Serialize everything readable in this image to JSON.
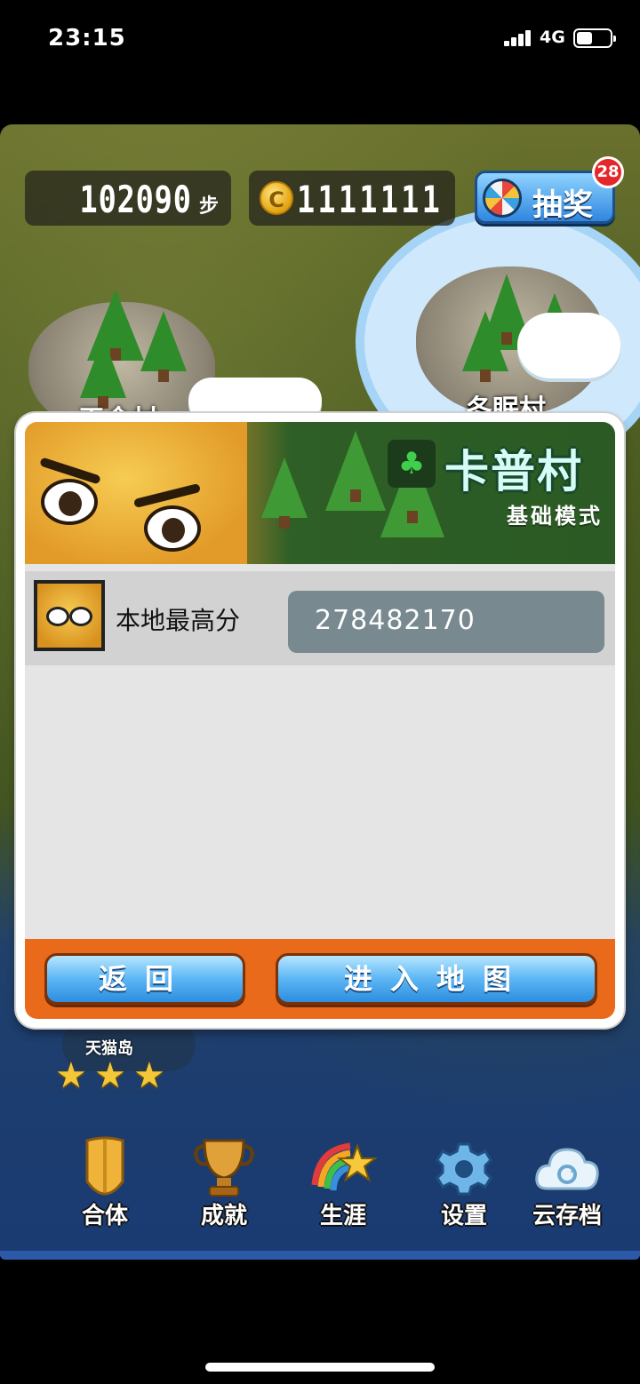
{
  "status_bar": {
    "time": "23:15",
    "network": "4G"
  },
  "hud": {
    "steps_value": "102090",
    "steps_unit": "步",
    "coin_symbol": "C",
    "coins_value": "1111111",
    "lottery_label": "抽奖",
    "lottery_badge": "28"
  },
  "map": {
    "left_village_name": "天金村",
    "right_village_name": "冬眠村"
  },
  "dialog": {
    "village_title": "卡普村",
    "mode": "基础模式",
    "score_label": "本地最高分",
    "score_value": "278482170",
    "back_button": "返回",
    "enter_button": "进入地图"
  },
  "island": {
    "name": "天猫岛",
    "stars_earned": 3,
    "stars_total": 3
  },
  "bottom_nav": [
    {
      "label": "合体",
      "icon": "bell-tail-icon"
    },
    {
      "label": "成就",
      "icon": "trophy-icon"
    },
    {
      "label": "生涯",
      "icon": "rainbow-star-icon"
    },
    {
      "label": "设置",
      "icon": "gear-icon"
    },
    {
      "label": "云存档",
      "icon": "cloud-sync-icon"
    }
  ],
  "colors": {
    "accent_orange": "#ea6a1c",
    "button_blue": "#5cb6f4",
    "badge_red": "#e7262a",
    "score_box": "#78898f"
  }
}
